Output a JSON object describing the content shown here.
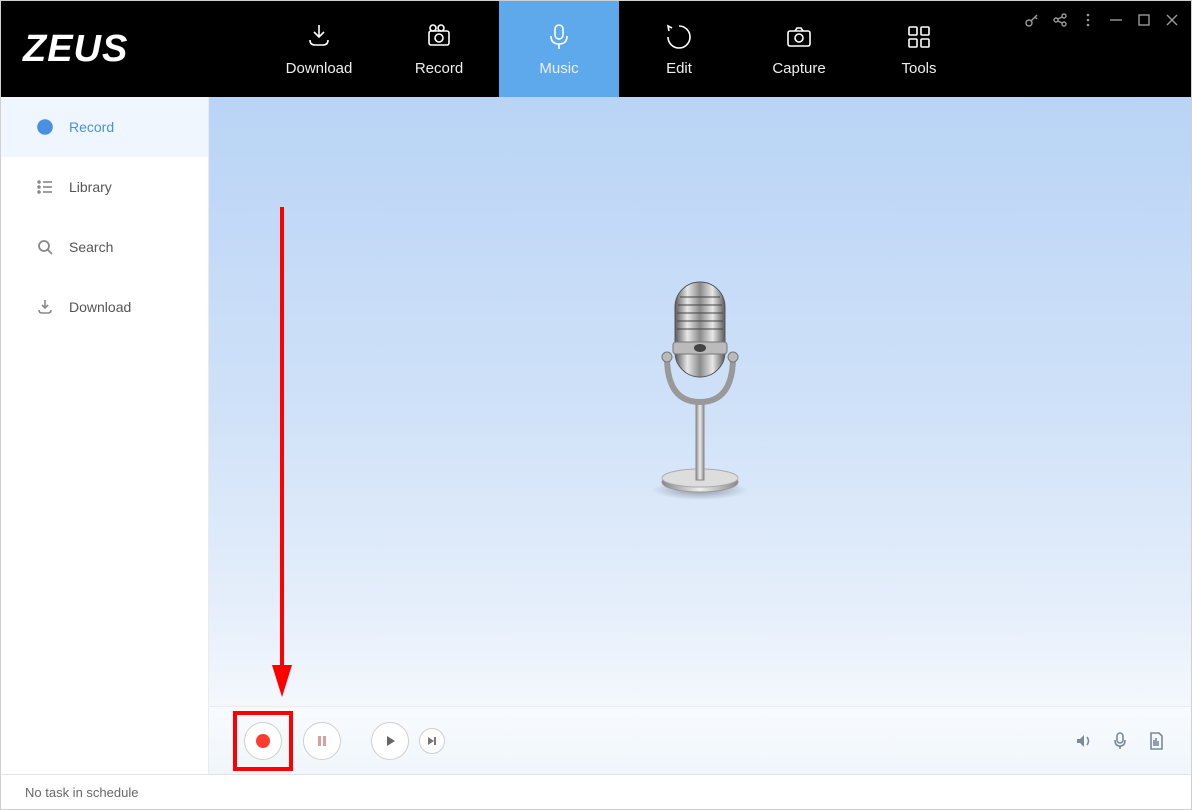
{
  "app": {
    "name": "ZEUS"
  },
  "tabs": [
    {
      "label": "Download"
    },
    {
      "label": "Record"
    },
    {
      "label": "Music"
    },
    {
      "label": "Edit"
    },
    {
      "label": "Capture"
    },
    {
      "label": "Tools"
    }
  ],
  "sidebar": {
    "items": [
      {
        "label": "Record"
      },
      {
        "label": "Library"
      },
      {
        "label": "Search"
      },
      {
        "label": "Download"
      }
    ]
  },
  "status": {
    "text": "No task in schedule"
  },
  "colors": {
    "accent": "#5ea9eb",
    "annotation": "#ff0000",
    "record_dot": "#ff3b30"
  }
}
